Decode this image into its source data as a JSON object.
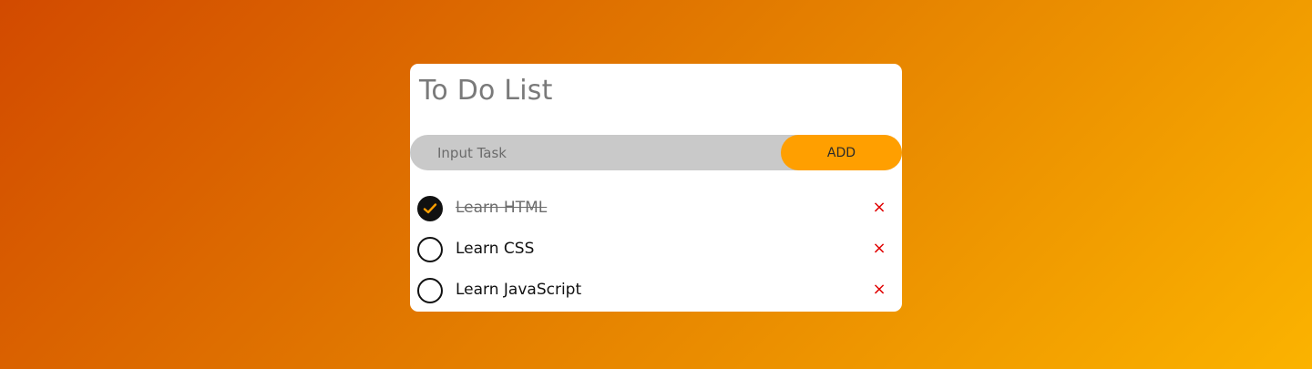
{
  "app": {
    "title": "To Do List"
  },
  "input": {
    "placeholder": "Input Task",
    "value": "",
    "add_label": "ADD"
  },
  "tasks": [
    {
      "label": "Learn HTML",
      "completed": true,
      "delete_glyph": "×"
    },
    {
      "label": "Learn CSS",
      "completed": false,
      "delete_glyph": "×"
    },
    {
      "label": "Learn JavaScript",
      "completed": false,
      "delete_glyph": "×"
    }
  ],
  "colors": {
    "accent": "#ff9f00",
    "delete": "#e00000",
    "input_bg": "#c9c9c9",
    "gradient_start": "#d24a00",
    "gradient_end": "#fbb300"
  },
  "icons": {
    "checked": "checkmark-icon",
    "unchecked": "empty-circle-icon",
    "delete": "close-icon"
  }
}
